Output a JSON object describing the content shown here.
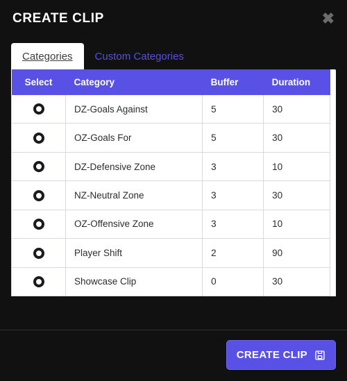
{
  "header": {
    "title": "CREATE CLIP"
  },
  "tabs": {
    "categories": "Categories",
    "custom": "Custom Categories"
  },
  "table": {
    "headers": {
      "select": "Select",
      "category": "Category",
      "buffer": "Buffer",
      "duration": "Duration"
    },
    "rows": [
      {
        "category": "DZ-Goals Against",
        "buffer": "5",
        "duration": "30"
      },
      {
        "category": "OZ-Goals For",
        "buffer": "5",
        "duration": "30"
      },
      {
        "category": "DZ-Defensive Zone",
        "buffer": "3",
        "duration": "10"
      },
      {
        "category": "NZ-Neutral Zone",
        "buffer": "3",
        "duration": "30"
      },
      {
        "category": "OZ-Offensive Zone",
        "buffer": "3",
        "duration": "10"
      },
      {
        "category": "Player Shift",
        "buffer": "2",
        "duration": "90"
      },
      {
        "category": "Showcase Clip",
        "buffer": "0",
        "duration": "30"
      }
    ]
  },
  "footer": {
    "create_label": "CREATE CLIP"
  }
}
